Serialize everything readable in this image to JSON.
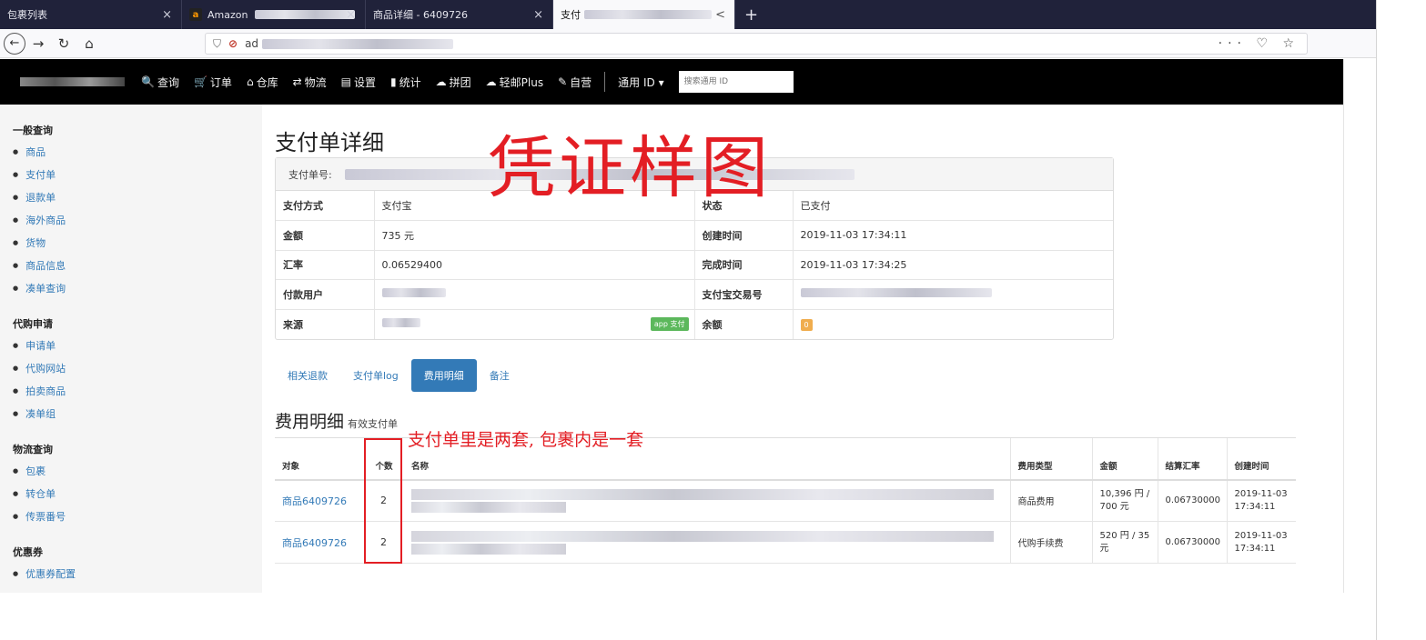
{
  "browser": {
    "tabs": [
      {
        "title": "包裹列表",
        "close": "×",
        "active": false
      },
      {
        "title": "Amazon",
        "close": "×",
        "active": false,
        "favicon": "a"
      },
      {
        "title": "商品详细 - 6409726",
        "close": "×",
        "active": false
      },
      {
        "title": "支付",
        "close": "<",
        "active": true
      }
    ],
    "new_tab": "+",
    "url_prefix": "ad",
    "right_icons": "··· ♡ ☆"
  },
  "appnav": {
    "items": [
      {
        "icon": "🔍",
        "label": "查询"
      },
      {
        "icon": "🛒",
        "label": "订单"
      },
      {
        "icon": "⌂",
        "label": "仓库"
      },
      {
        "icon": "⇄",
        "label": "物流"
      },
      {
        "icon": "▤",
        "label": "设置"
      },
      {
        "icon": "▮",
        "label": "统计"
      },
      {
        "icon": "☁",
        "label": "拼团"
      },
      {
        "icon": "☁",
        "label": "轻邮Plus"
      },
      {
        "icon": "✎",
        "label": "自营"
      }
    ],
    "general_id": "通用 ID ▾",
    "search_placeholder": "搜索通用 ID"
  },
  "sidebar": {
    "groups": [
      {
        "title": "一般查询",
        "items": [
          "商品",
          "支付单",
          "退款单",
          "海外商品",
          "货物",
          "商品信息",
          "凑单查询"
        ]
      },
      {
        "title": "代购申请",
        "items": [
          "申请单",
          "代购网站",
          "拍卖商品",
          "凑单组"
        ]
      },
      {
        "title": "物流查询",
        "items": [
          "包裹",
          "转仓单",
          "传票番号"
        ]
      },
      {
        "title": "优惠券",
        "items": [
          "优惠券配置"
        ]
      }
    ]
  },
  "page": {
    "title": "支付单详细",
    "watermark": "凭证样图",
    "detail_head_label": "支付单号:",
    "rows": [
      {
        "k1": "支付方式",
        "v1": "支付宝",
        "k2": "状态",
        "v2": "已支付"
      },
      {
        "k1": "金额",
        "v1": "735 元",
        "k2": "创建时间",
        "v2": "2019-11-03 17:34:11"
      },
      {
        "k1": "汇率",
        "v1": "0.06529400",
        "k2": "完成时间",
        "v2": "2019-11-03 17:34:25"
      },
      {
        "k1": "付款用户",
        "v1": "",
        "k2": "支付宝交易号",
        "v2": ""
      },
      {
        "k1": "来源",
        "v1": "",
        "k2": "余额",
        "v2": ""
      }
    ],
    "source_badge": "app 支付",
    "balance_badge": "0",
    "tabs": [
      "相关退款",
      "支付单log",
      "费用明细",
      "备注"
    ],
    "active_tab": "费用明细",
    "section_title": "费用明细",
    "section_sub": "有效支付单",
    "annotation": "支付单里是两套, 包裹内是一套",
    "fees": {
      "headers": [
        "对象",
        "个数",
        "名称",
        "费用类型",
        "金额",
        "结算汇率",
        "创建时间"
      ],
      "rows": [
        {
          "obj": "商品6409726",
          "qty": "2",
          "type": "商品费用",
          "amount": "10,396 円 / 700 元",
          "rate": "0.06730000",
          "created": "2019-11-03 17:34:11"
        },
        {
          "obj": "商品6409726",
          "qty": "2",
          "type": "代购手续费",
          "amount": "520 円 / 35 元",
          "rate": "0.06730000",
          "created": "2019-11-03 17:34:11"
        }
      ]
    }
  },
  "colors": {
    "accent": "#337ab7",
    "annotation_red": "#e31e24",
    "nav_bg": "#000000",
    "tabbar_bg": "#20223a"
  }
}
